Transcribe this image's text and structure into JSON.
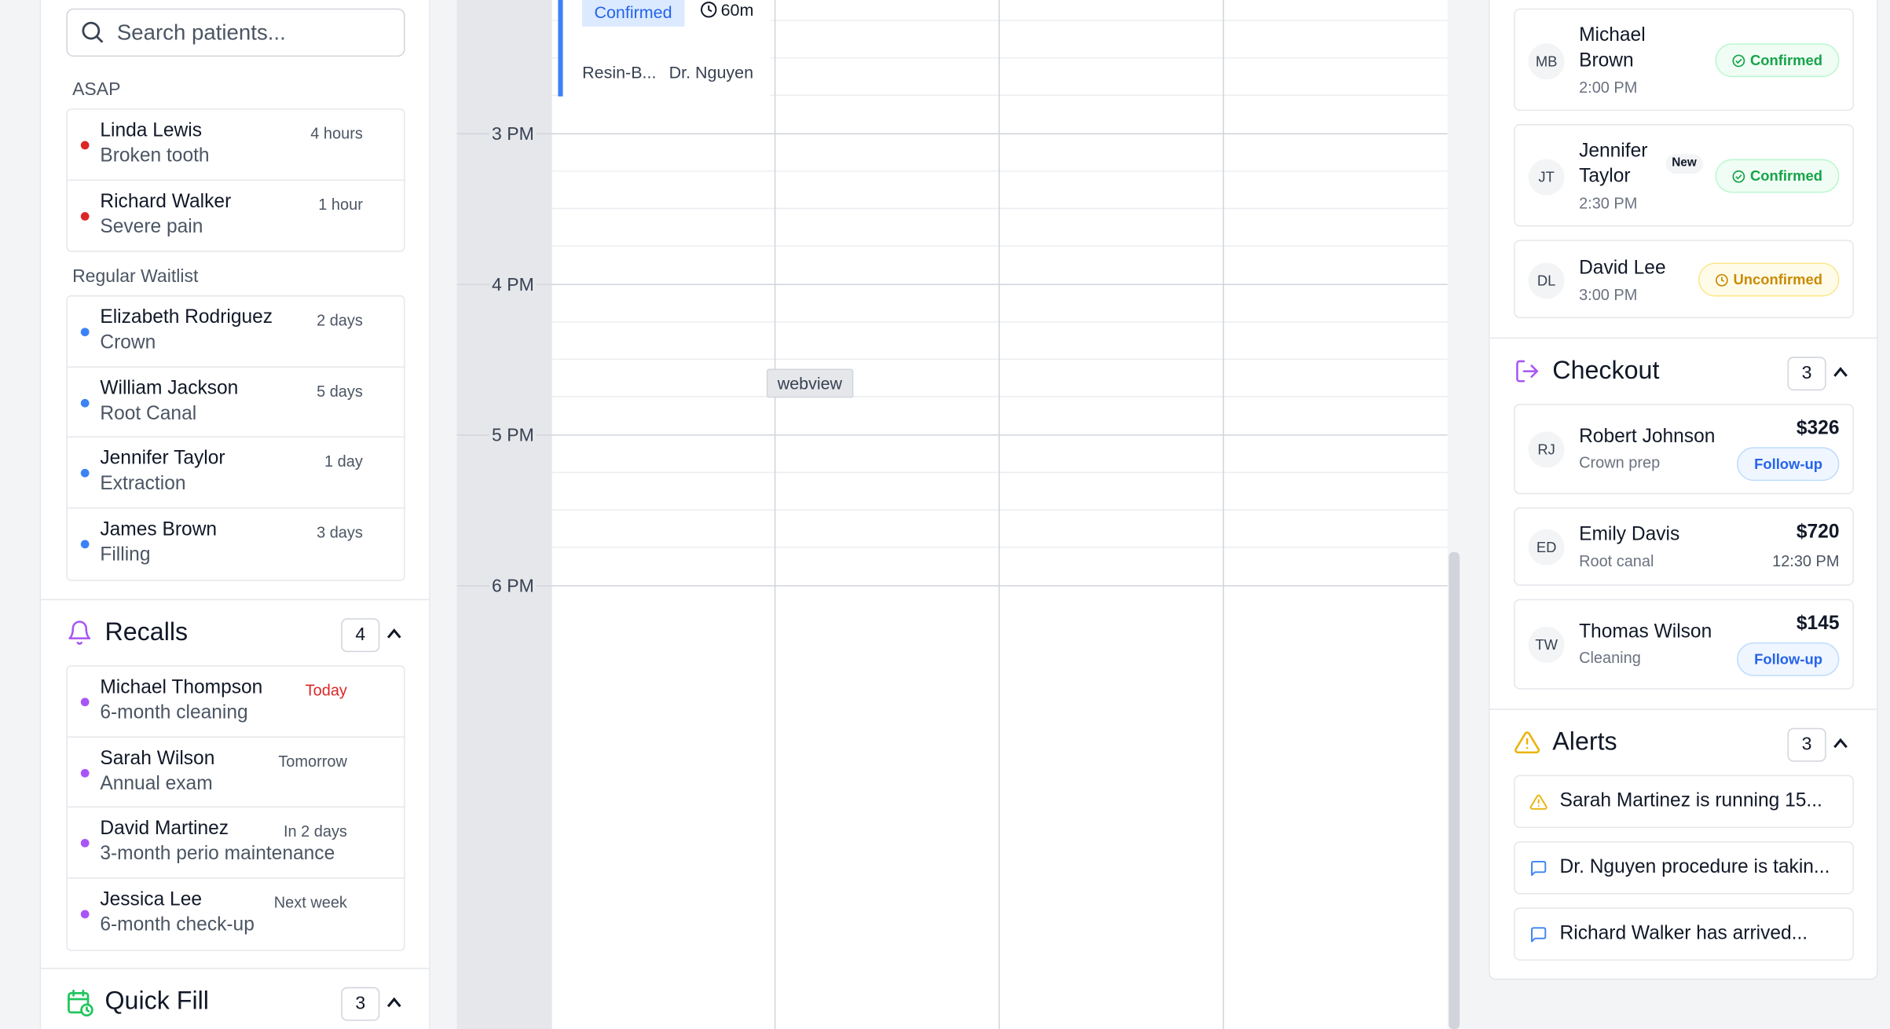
{
  "left": {
    "search_placeholder": "Search patients...",
    "asap_label": "ASAP",
    "asap": [
      {
        "name": "Linda Lewis",
        "reason": "Broken tooth",
        "wait": "4 hours"
      },
      {
        "name": "Richard Walker",
        "reason": "Severe pain",
        "wait": "1 hour"
      }
    ],
    "regular_label": "Regular Waitlist",
    "regular": [
      {
        "name": "Elizabeth Rodriguez",
        "reason": "Crown",
        "wait": "2 days"
      },
      {
        "name": "William Jackson",
        "reason": "Root Canal",
        "wait": "5 days"
      },
      {
        "name": "Jennifer Taylor",
        "reason": "Extraction",
        "wait": "1 day"
      },
      {
        "name": "James Brown",
        "reason": "Filling",
        "wait": "3 days"
      }
    ],
    "recalls": {
      "title": "Recalls",
      "count": "4",
      "items": [
        {
          "name": "Michael Thompson",
          "reason": "6-month cleaning",
          "when": "Today"
        },
        {
          "name": "Sarah Wilson",
          "reason": "Annual exam",
          "when": "Tomorrow"
        },
        {
          "name": "David Martinez",
          "reason": "3-month perio maintenance",
          "when": "In 2 days"
        },
        {
          "name": "Jessica Lee",
          "reason": "6-month check-up",
          "when": "Next week"
        }
      ]
    },
    "quick_fill": {
      "title": "Quick Fill",
      "count": "3"
    }
  },
  "calendar": {
    "hours": [
      "3 PM",
      "4 PM",
      "5 PM",
      "6 PM"
    ],
    "appointment": {
      "status": "Confirmed",
      "duration": "60m",
      "procedure": "Resin-B...",
      "doctor": "Dr. Nguyen"
    },
    "tooltip": "webview"
  },
  "right": {
    "arrivals": [
      {
        "initials": "MB",
        "first": "Michael",
        "last": "Brown",
        "time": "2:00 PM",
        "status": "Confirmed",
        "status_color": "#16a34a"
      },
      {
        "initials": "JT",
        "first": "Jennifer",
        "last": "Taylor",
        "time": "2:30 PM",
        "status": "Confirmed",
        "status_color": "#16a34a",
        "tag": "New"
      },
      {
        "initials": "DL",
        "first": "David Lee",
        "time": "3:00 PM",
        "status": "Unconfirmed",
        "status_color": "#ca8a04"
      }
    ],
    "checkout": {
      "title": "Checkout",
      "count": "3",
      "items": [
        {
          "initials": "RJ",
          "name": "Robert Johnson",
          "detail": "Crown prep",
          "amount": "$326",
          "badge": "Follow-up"
        },
        {
          "initials": "ED",
          "name": "Emily Davis",
          "detail": "Root canal",
          "amount": "$720",
          "time": "12:30 PM"
        },
        {
          "initials": "TW",
          "name": "Thomas Wilson",
          "detail": "Cleaning",
          "amount": "$145",
          "badge": "Follow-up"
        }
      ]
    },
    "alerts": {
      "title": "Alerts",
      "count": "3",
      "items": [
        {
          "text": "Sarah Martinez is running 15...",
          "icon": "warning-icon"
        },
        {
          "text": "Dr. Nguyen procedure is takin...",
          "icon": "message-icon"
        },
        {
          "text": "Richard Walker has arrived...",
          "icon": "message-icon"
        }
      ]
    }
  }
}
